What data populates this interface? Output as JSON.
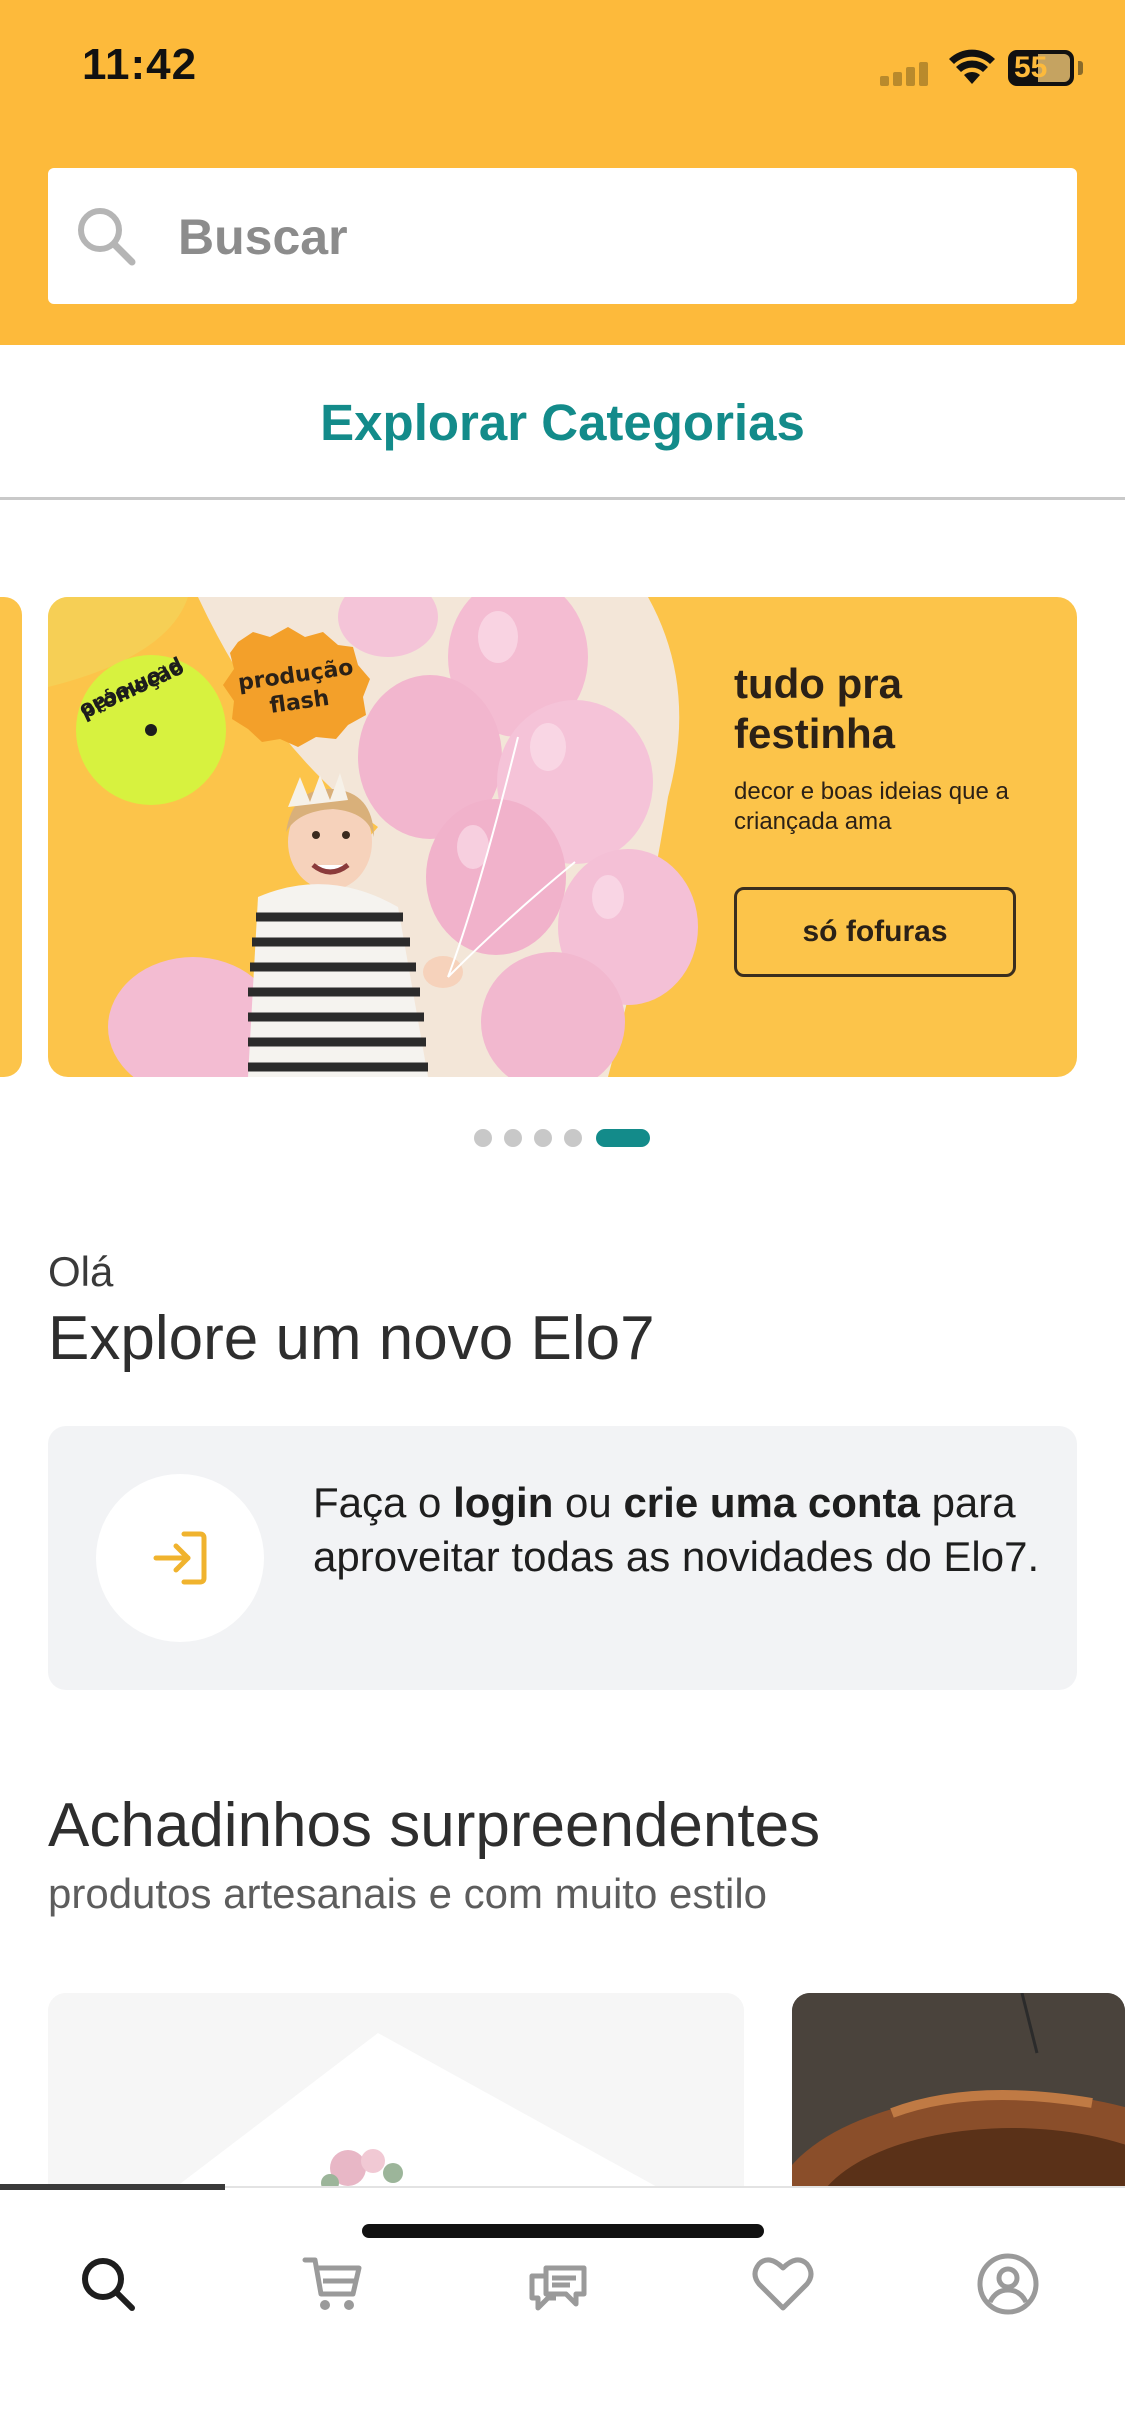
{
  "status_bar": {
    "time": "11:42",
    "battery": "55"
  },
  "search": {
    "placeholder": "Buscar",
    "icon": "search-icon"
  },
  "explore": {
    "label": "Explorar Categorias"
  },
  "banner": {
    "badge_promo": "promoção",
    "badge_flash": "produção flash",
    "title": "tudo pra festinha",
    "subtitle": "decor e boas ideias que a criançada ama",
    "button_label": "só fofuras",
    "total_slides": 5,
    "active_slide": 5
  },
  "greeting": {
    "hello": "Olá",
    "title": "Explore um novo Elo7"
  },
  "login_card": {
    "text_prefix": "Faça o ",
    "login_link": "login",
    "text_middle": " ou ",
    "signup_link": "crie uma conta",
    "text_suffix": " para aproveitar todas as novidades do Elo7.",
    "icon": "login-icon"
  },
  "section": {
    "title": "Achadinhos surpreendentes",
    "subtitle": "produtos artesanais e com muito estilo"
  },
  "tabbar": {
    "items": [
      {
        "name": "search",
        "icon": "search-icon",
        "active": true
      },
      {
        "name": "cart",
        "icon": "cart-icon",
        "active": false
      },
      {
        "name": "messages",
        "icon": "chat-icon",
        "active": false
      },
      {
        "name": "favorites",
        "icon": "heart-icon",
        "active": false
      },
      {
        "name": "account",
        "icon": "user-icon",
        "active": false
      }
    ]
  },
  "colors": {
    "brand_yellow": "#fdba3b",
    "brand_teal": "#138b8a",
    "banner_yellow": "#fcc44a"
  }
}
